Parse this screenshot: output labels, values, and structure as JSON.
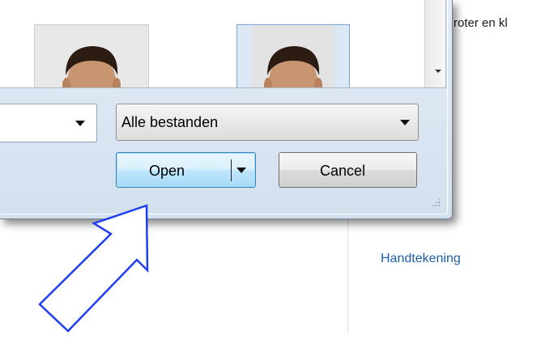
{
  "background": {
    "top_text": "roter en kl",
    "link": "Handtekening"
  },
  "dialog": {
    "file_type_filter": {
      "selected": "Alle bestanden"
    },
    "buttons": {
      "open_label": "Open",
      "cancel_label": "Cancel"
    }
  },
  "colors": {
    "arrow": "#1f3df2",
    "link": "#1f5fa8",
    "open_button": "#bee6fd"
  },
  "icons": {
    "dropdown": "chevron-down-icon",
    "scroll_down": "scroll-down-arrow-icon",
    "split": "split-dropdown-arrow-icon",
    "callout": "callout-arrow-icon"
  }
}
